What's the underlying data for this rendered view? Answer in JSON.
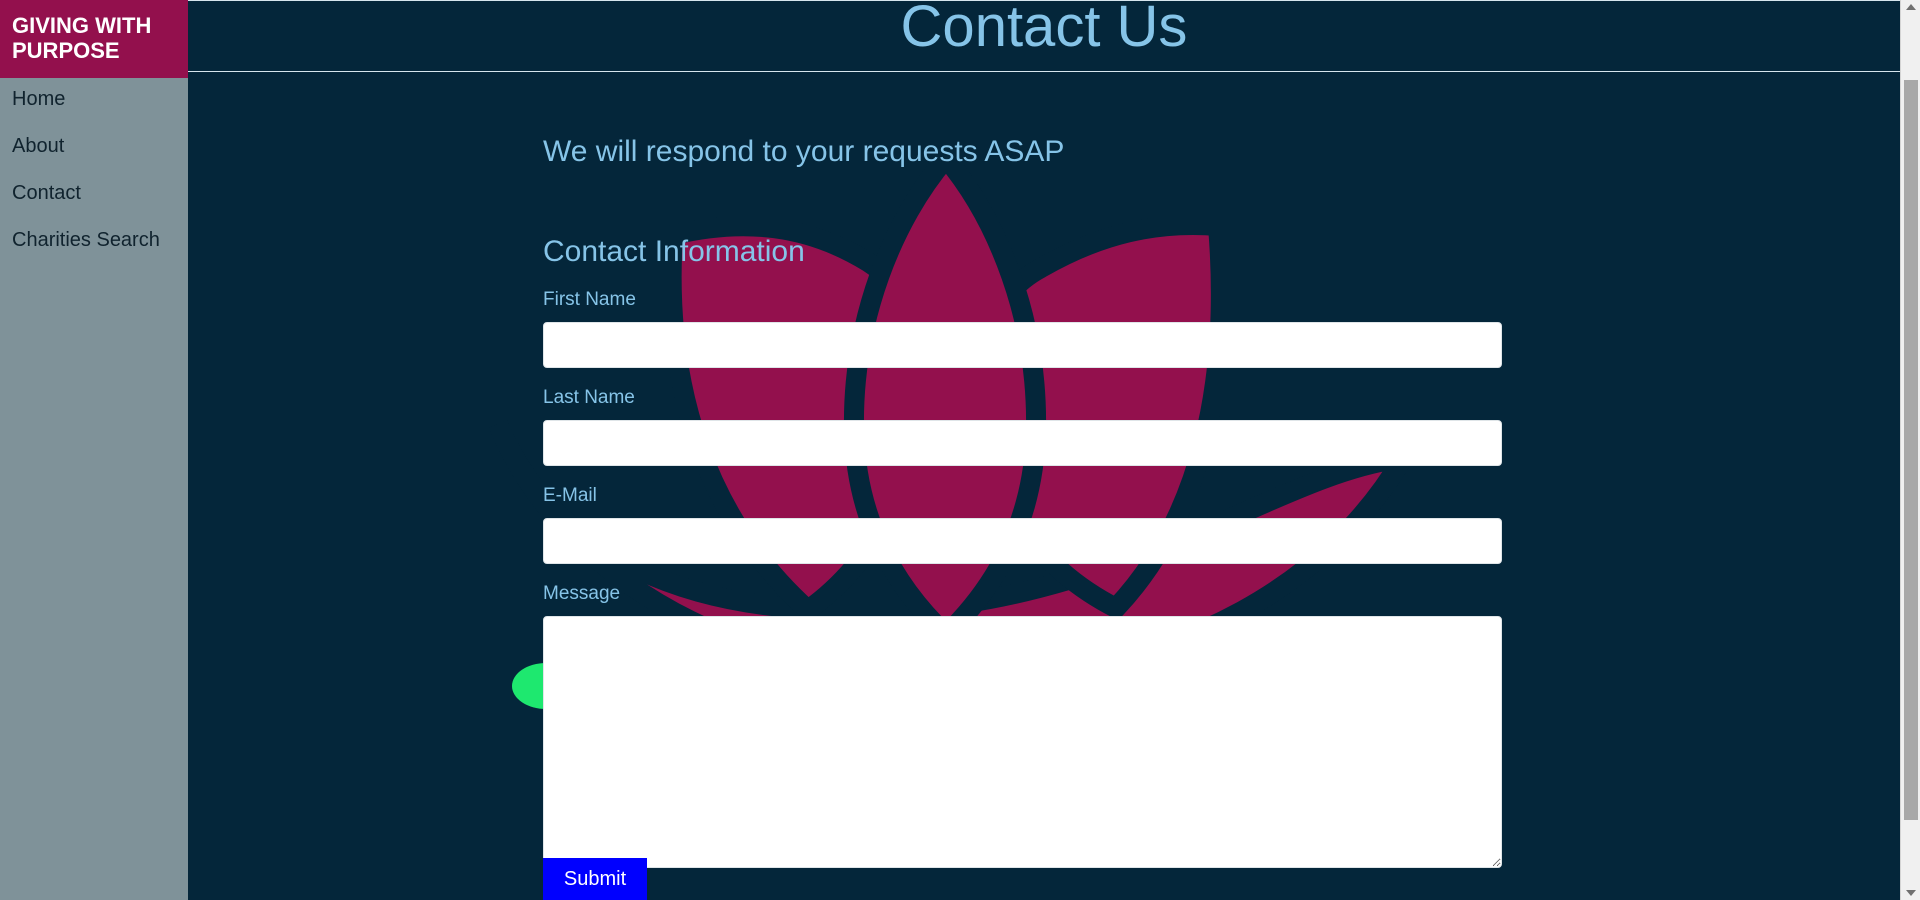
{
  "sidebar": {
    "brand": "GIVING WITH PURPOSE",
    "items": [
      {
        "label": "Home"
      },
      {
        "label": "About"
      },
      {
        "label": "Contact"
      },
      {
        "label": "Charities Search"
      }
    ]
  },
  "header": {
    "title": "Contact Us"
  },
  "main": {
    "subheading": "We will respond to your requests ASAP",
    "section_title": "Contact Information",
    "form": {
      "first_name_label": "First Name",
      "first_name_value": "",
      "last_name_label": "Last Name",
      "last_name_value": "",
      "email_label": "E-Mail",
      "email_value": "",
      "message_label": "Message",
      "message_value": "",
      "submit_label": "Submit"
    }
  },
  "colors": {
    "background": "#04263a",
    "sidebar": "#7f9299",
    "brand": "#93104d",
    "text_accent": "#86c4e8",
    "submit": "#0000ff",
    "lotus": "#93104d",
    "green_accent": "#1ee86f"
  }
}
